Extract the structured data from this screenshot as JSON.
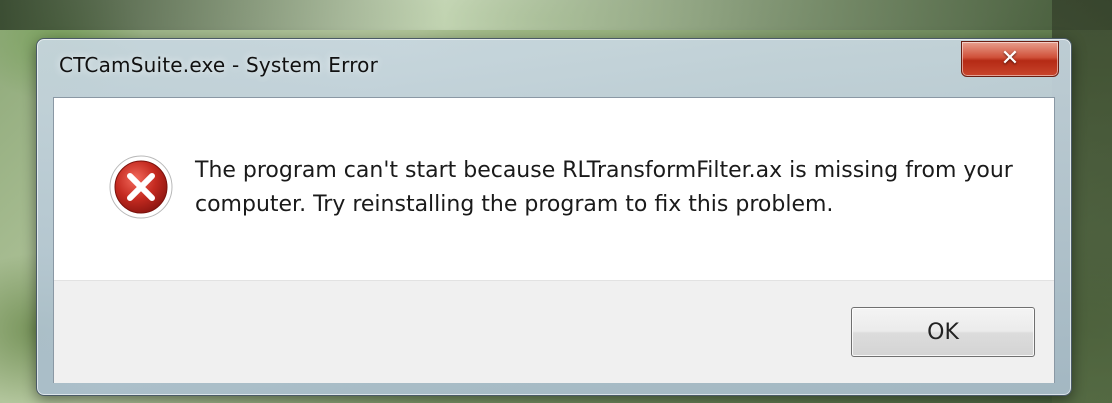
{
  "window": {
    "title": "CTCamSuite.exe - System Error",
    "close_glyph": "✕"
  },
  "dialog": {
    "icon": "error-icon",
    "message": "The program can't start because RLTransformFilter.ax is missing from your computer. Try reinstalling the program to fix this problem.",
    "ok_label": "OK"
  },
  "colors": {
    "close_button": "#c8452c",
    "error_icon": "#c42a20",
    "client_background": "#ffffff",
    "button_area_background": "#f0f0f0"
  }
}
